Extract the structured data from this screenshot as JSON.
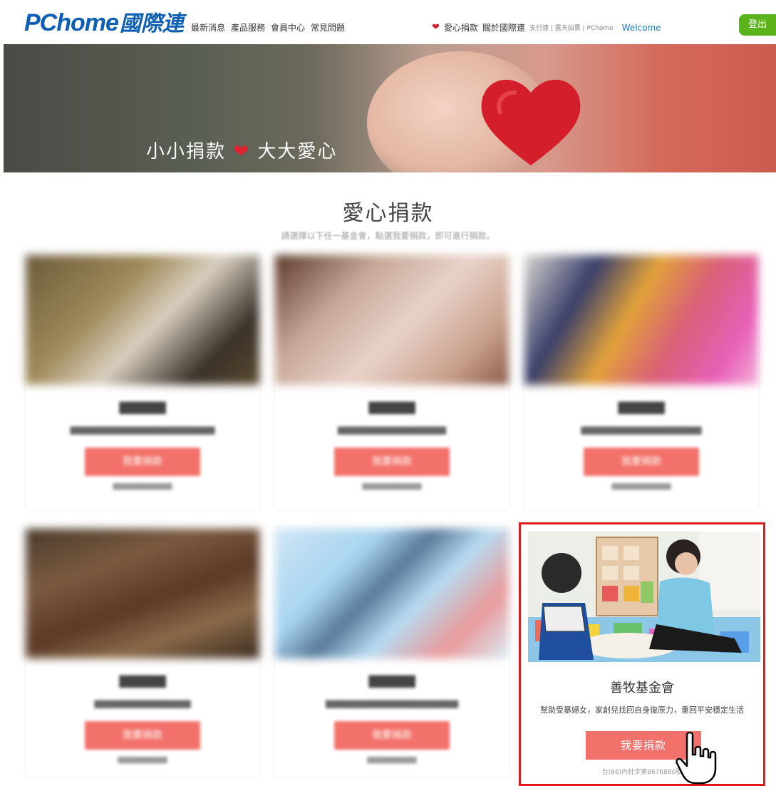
{
  "header": {
    "logo_text": "PChome",
    "logo_cn": "國際連",
    "nav": [
      "最新消息",
      "產品服務",
      "會員中心",
      "常見問題"
    ],
    "right": {
      "donate": "愛心捐款",
      "about": "關於國際連",
      "links": "支付連 | 露天拍賣 | PChome",
      "welcome": "Welcome"
    },
    "logout": "登出"
  },
  "banner": {
    "slogan_left": "小小捐款",
    "slogan_right": "大大愛心"
  },
  "section": {
    "title": "愛心捐款",
    "subtitle": "請選擇以下任一基金會，點選我要捐款，即可進行捐款。"
  },
  "featured": {
    "title": "善牧基金會",
    "description": "幫助受暴婦女，家創兒找回自身復原力，重回平安穩定生活",
    "button": "我要捐款",
    "footnote": "台(86)內社字第8676880號"
  },
  "blurred_cards": {
    "button": "我要捐款"
  },
  "colors": {
    "brand_blue": "#0d5fb3",
    "accent_red": "#f2726b",
    "logout_green": "#5bb31c",
    "highlight_border": "#e0191d"
  }
}
